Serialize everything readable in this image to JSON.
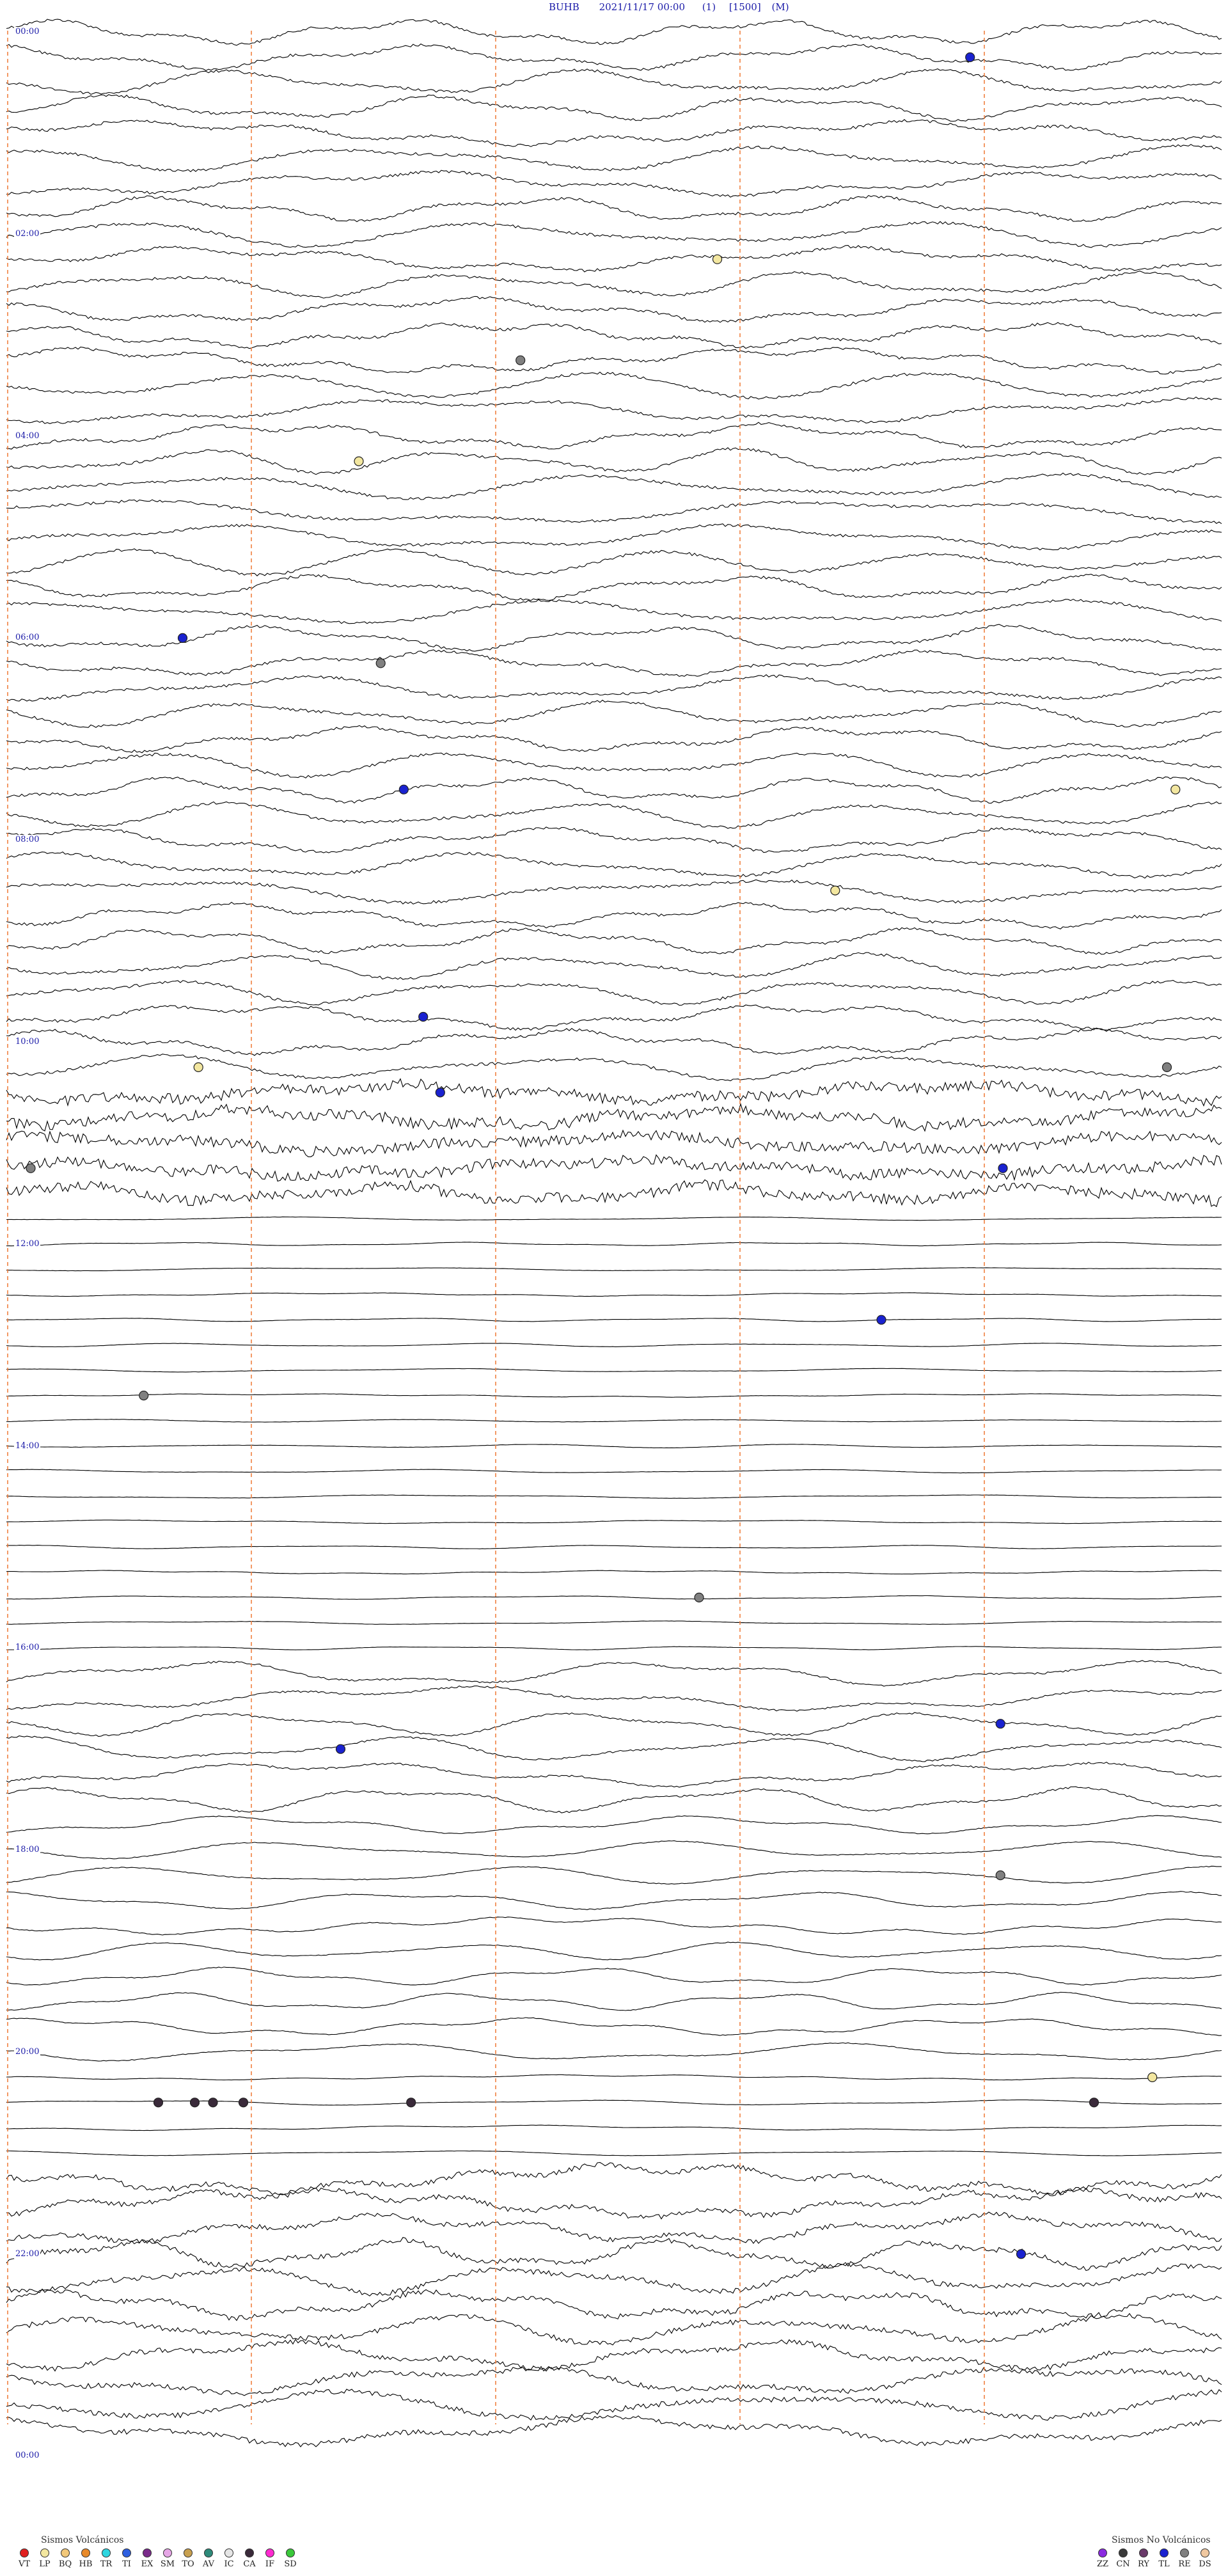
{
  "header": {
    "station": "BUHB",
    "date": "2021/11/17 00:00",
    "channel": "(1)",
    "scale": "[1500]",
    "unit": "(M)"
  },
  "chart_data": {
    "type": "line",
    "title": "BUHB 2021/11/17 00:00 (1) [1500] (M)",
    "xlabel": "",
    "ylabel": "",
    "rows": 96,
    "minutes_per_row": 15,
    "hour_labels": [
      "00:00",
      "02:00",
      "04:00",
      "06:00",
      "08:00",
      "10:00",
      "12:00",
      "14:00",
      "16:00",
      "18:00",
      "20:00",
      "22:00",
      "00:00"
    ],
    "grid": true,
    "events": [
      {
        "row": 1,
        "x_frac": 0.793,
        "type": "TL"
      },
      {
        "row": 9,
        "x_frac": 0.585,
        "type": "LP"
      },
      {
        "row": 13,
        "x_frac": 0.423,
        "type": "RE"
      },
      {
        "row": 17,
        "x_frac": 0.29,
        "type": "LP"
      },
      {
        "row": 24,
        "x_frac": 0.145,
        "type": "TL"
      },
      {
        "row": 25,
        "x_frac": 0.308,
        "type": "RE"
      },
      {
        "row": 30,
        "x_frac": 0.327,
        "type": "TL"
      },
      {
        "row": 30,
        "x_frac": 0.962,
        "type": "LP"
      },
      {
        "row": 34,
        "x_frac": 0.682,
        "type": "LP"
      },
      {
        "row": 39,
        "x_frac": 0.343,
        "type": "TL"
      },
      {
        "row": 41,
        "x_frac": 0.158,
        "type": "LP"
      },
      {
        "row": 41,
        "x_frac": 0.955,
        "type": "RE"
      },
      {
        "row": 42,
        "x_frac": 0.357,
        "type": "TL"
      },
      {
        "row": 45,
        "x_frac": 0.02,
        "type": "RE"
      },
      {
        "row": 45,
        "x_frac": 0.82,
        "type": "TL"
      },
      {
        "row": 51,
        "x_frac": 0.72,
        "type": "TL"
      },
      {
        "row": 54,
        "x_frac": 0.113,
        "type": "RE"
      },
      {
        "row": 62,
        "x_frac": 0.57,
        "type": "RE"
      },
      {
        "row": 67,
        "x_frac": 0.818,
        "type": "TL"
      },
      {
        "row": 68,
        "x_frac": 0.275,
        "type": "TL"
      },
      {
        "row": 73,
        "x_frac": 0.818,
        "type": "RE"
      },
      {
        "row": 81,
        "x_frac": 0.943,
        "type": "LP"
      },
      {
        "row": 82,
        "x_frac": 0.125,
        "type": "CA"
      },
      {
        "row": 82,
        "x_frac": 0.155,
        "type": "CA"
      },
      {
        "row": 82,
        "x_frac": 0.17,
        "type": "CA"
      },
      {
        "row": 82,
        "x_frac": 0.195,
        "type": "CA"
      },
      {
        "row": 82,
        "x_frac": 0.333,
        "type": "CA"
      },
      {
        "row": 82,
        "x_frac": 0.895,
        "type": "CA"
      },
      {
        "row": 88,
        "x_frac": 0.835,
        "type": "TL"
      }
    ],
    "volcanic_legend_title": "Sismos Volcánicos",
    "nonvolcanic_legend_title": "Sismos No Volcánicos",
    "volcanic_types": [
      {
        "code": "VT",
        "color": "#e02020"
      },
      {
        "code": "LP",
        "color": "#f3e7a0"
      },
      {
        "code": "BQ",
        "color": "#f2c87a"
      },
      {
        "code": "HB",
        "color": "#e88a2a"
      },
      {
        "code": "TR",
        "color": "#2fd6e0"
      },
      {
        "code": "TI",
        "color": "#2e5fe0"
      },
      {
        "code": "EX",
        "color": "#7a2a8a"
      },
      {
        "code": "SM",
        "color": "#e6a6e6"
      },
      {
        "code": "TO",
        "color": "#c8a050"
      },
      {
        "code": "AV",
        "color": "#2e8a7a"
      },
      {
        "code": "IC",
        "color": "#e6e6e6"
      },
      {
        "code": "CA",
        "color": "#3a2a3a"
      },
      {
        "code": "IF",
        "color": "#ff2ad0"
      },
      {
        "code": "SD",
        "color": "#3ac83a"
      }
    ],
    "nonvolcanic_types": [
      {
        "code": "ZZ",
        "color": "#8a2ae0"
      },
      {
        "code": "CN",
        "color": "#3a3a3a"
      },
      {
        "code": "RY",
        "color": "#6a3a6a"
      },
      {
        "code": "TL",
        "color": "#1a22d0"
      },
      {
        "code": "RE",
        "color": "#808080"
      },
      {
        "code": "DS",
        "color": "#f0c8a0"
      }
    ]
  }
}
